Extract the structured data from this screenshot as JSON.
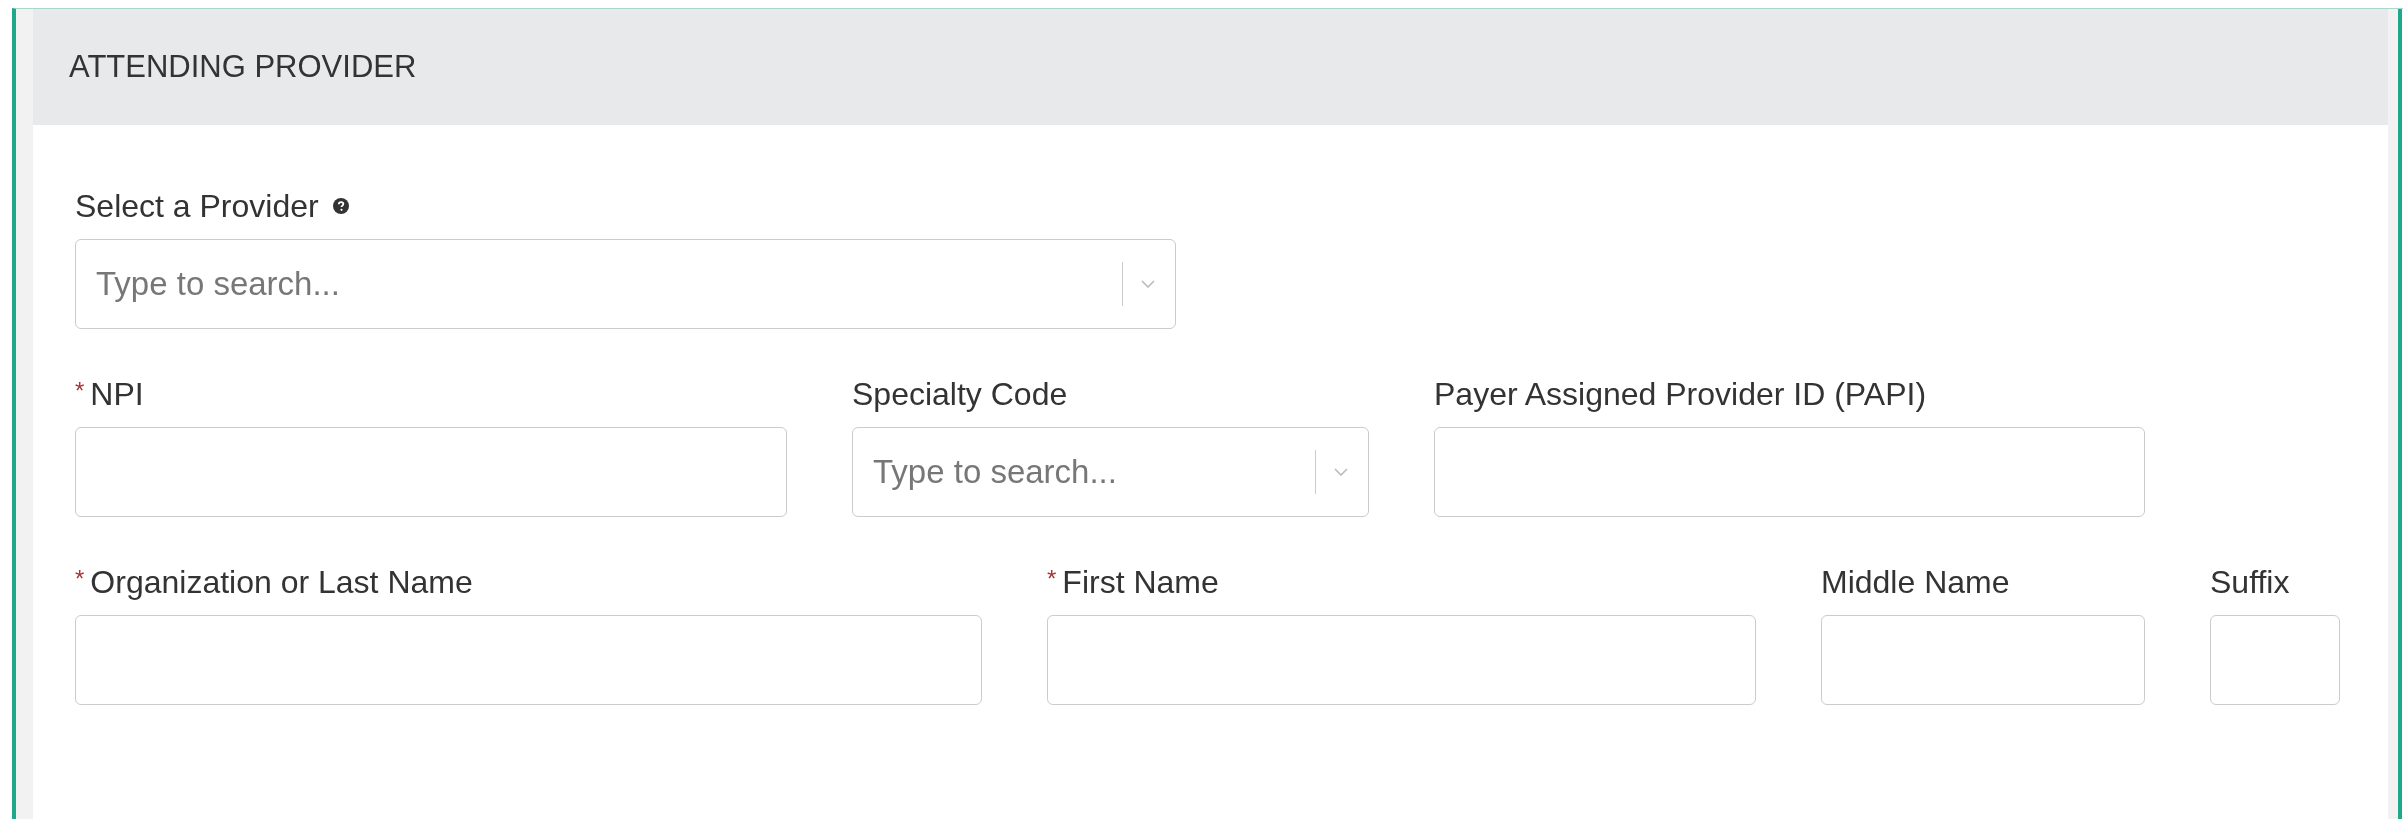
{
  "section": {
    "title": "ATTENDING PROVIDER"
  },
  "rows": [
    [
      {
        "label": "Select a Provider",
        "help": true,
        "kind": "select",
        "placeholder": "Type to search..."
      }
    ],
    [
      {
        "label": "NPI",
        "marker": "*",
        "kind": "text"
      },
      {
        "label": "Specialty Code",
        "kind": "select",
        "placeholder": "Type to search..."
      },
      {
        "label": "Payer Assigned Provider ID (PAPI)",
        "kind": "text"
      }
    ],
    [
      {
        "label": "Organization or Last Name",
        "marker": "*",
        "kind": "text"
      },
      {
        "label": "First Name",
        "marker": "*",
        "kind": "text"
      },
      {
        "label": "Middle Name",
        "kind": "text"
      },
      {
        "label": "Suffix",
        "kind": "text"
      }
    ]
  ]
}
